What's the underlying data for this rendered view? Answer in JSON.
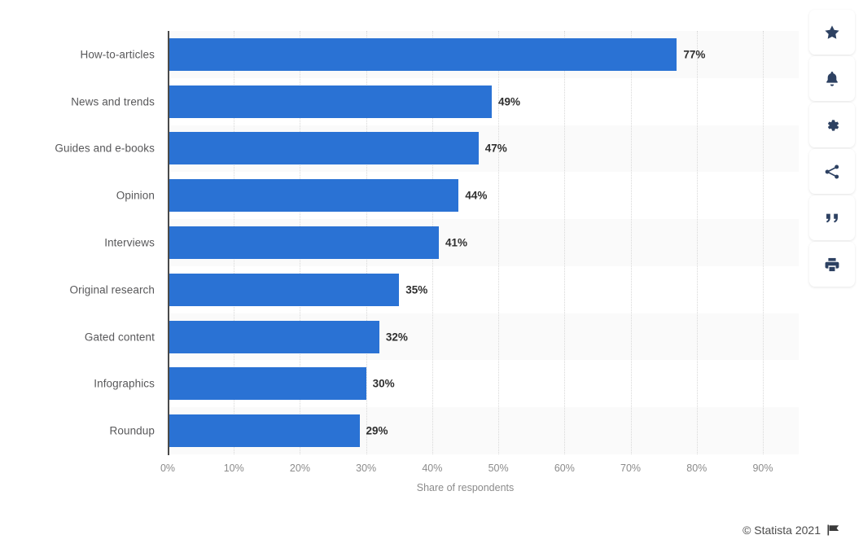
{
  "chart_data": {
    "type": "bar",
    "orientation": "horizontal",
    "title": "",
    "xlabel": "Share of respondents",
    "ylabel": "",
    "xlim": [
      0,
      90
    ],
    "grid": true,
    "legend": null,
    "value_suffix": "%",
    "categories": [
      "How-to-articles",
      "News and trends",
      "Guides and e-books",
      "Opinion",
      "Interviews",
      "Original research",
      "Gated content",
      "Infographics",
      "Roundup"
    ],
    "values": [
      77,
      49,
      47,
      44,
      41,
      35,
      32,
      30,
      29
    ],
    "value_labels": [
      "77%",
      "49%",
      "47%",
      "44%",
      "41%",
      "35%",
      "32%",
      "30%",
      "29%"
    ],
    "xticks": [
      0,
      10,
      20,
      30,
      40,
      50,
      60,
      70,
      80,
      90
    ],
    "xtick_labels": [
      "0%",
      "10%",
      "20%",
      "30%",
      "40%",
      "50%",
      "60%",
      "70%",
      "80%",
      "90%"
    ],
    "bar_color": "#2a72d4",
    "band_color": "#fafafa",
    "axis_color": "#4a4a4a",
    "gridline_color": "#d8d8d8",
    "label_color": "#58585a",
    "value_color": "#2f2f2f"
  },
  "footer": {
    "credit": "© Statista 2021",
    "flag_icon": "flag-icon"
  },
  "toolbar": {
    "buttons": [
      {
        "name": "favorite-button",
        "icon": "star-icon",
        "label": "Add to favorites"
      },
      {
        "name": "alert-button",
        "icon": "bell-icon",
        "label": "Create alert"
      },
      {
        "name": "settings-button",
        "icon": "gear-icon",
        "label": "Settings"
      },
      {
        "name": "share-button",
        "icon": "share-icon",
        "label": "Share"
      },
      {
        "name": "cite-button",
        "icon": "quote-icon",
        "label": "Cite"
      },
      {
        "name": "print-button",
        "icon": "print-icon",
        "label": "Print"
      }
    ],
    "icon_color": "#2d4162"
  }
}
